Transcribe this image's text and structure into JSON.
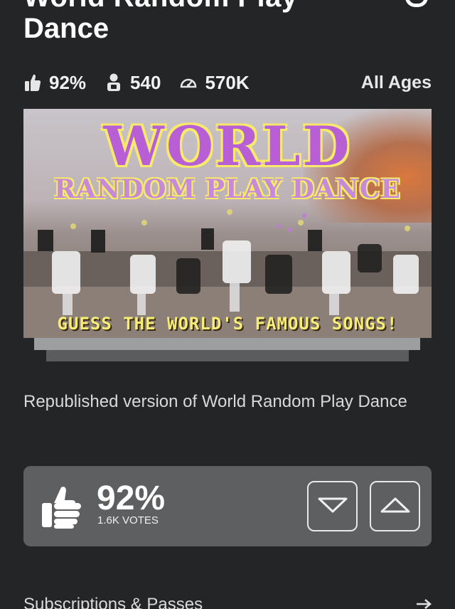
{
  "header": {
    "title_line_1": "World Random Play",
    "title_line_2": "Dance"
  },
  "stats": {
    "rating": "92%",
    "playing": "540",
    "visits": "570K",
    "age_rating": "All Ages"
  },
  "thumbnail": {
    "headline": "WORLD",
    "subheadline": "RANDOM PLAY DANCE",
    "caption": "GUESS THE WORLD'S FAMOUS SONGS!"
  },
  "description": "Republished version of World Random Play Dance",
  "votes": {
    "percent": "92%",
    "count_label": "1.6K VOTES"
  },
  "sections": {
    "subscriptions": "Subscriptions & Passes"
  },
  "icons": {
    "rating": "thumbs-up-icon",
    "playing": "user-icon",
    "visits": "gauge-icon",
    "downvote": "chevron-down-icon",
    "upvote": "chevron-up-icon",
    "subs_arrow": "arrow-right-icon"
  }
}
